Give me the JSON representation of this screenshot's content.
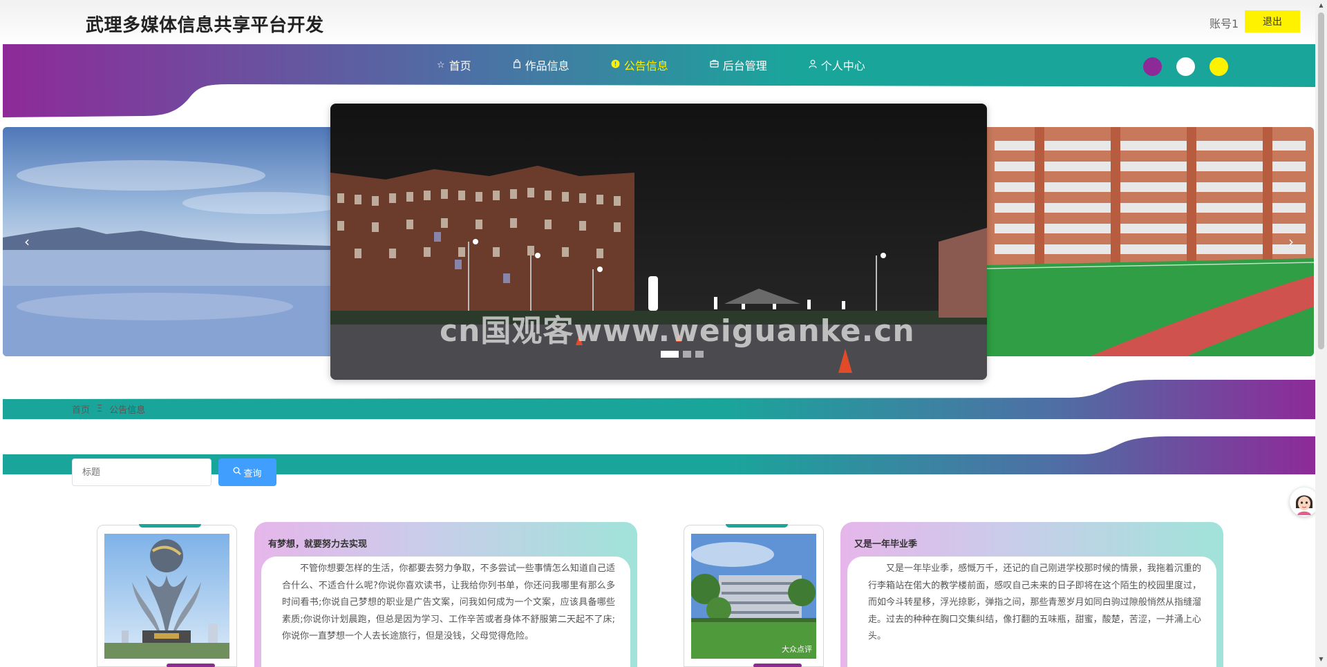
{
  "header": {
    "site_title": "武理多媒体信息共享平台开发",
    "account_label": "账号1",
    "logout_label": "退出"
  },
  "nav": {
    "items": [
      {
        "label": "首页",
        "icon": "star-icon",
        "active": false
      },
      {
        "label": "作品信息",
        "icon": "bag-icon",
        "active": false
      },
      {
        "label": "公告信息",
        "icon": "info-circle-icon",
        "active": true
      },
      {
        "label": "后台管理",
        "icon": "briefcase-icon",
        "active": false
      },
      {
        "label": "个人中心",
        "icon": "user-icon",
        "active": false
      }
    ],
    "theme_colors": [
      "#8e2a98",
      "#ffffff",
      "#fff200"
    ]
  },
  "colors": {
    "purple": "#8e2a98",
    "teal": "#1aa59b",
    "accent_yellow": "#fff200",
    "search_blue": "#409eff"
  },
  "carousel": {
    "watermark": "cn国观客www.weiguanke.cn",
    "slide_count": 3,
    "active_index": 0,
    "prev_icon": "chevron-left-icon",
    "next_icon": "chevron-right-icon"
  },
  "breadcrumb": {
    "home": "首页",
    "separator": "Ξ",
    "current": "公告信息"
  },
  "search": {
    "placeholder": "标题",
    "button_label": "查询",
    "button_icon": "search-icon"
  },
  "news": [
    {
      "title": "有梦想，就要努力去实现",
      "content": "不管你想要怎样的生活，你都要去努力争取，不多尝试一些事情怎么知道自己适合什么、不适合什么呢?你说你喜欢读书，让我给你列书单，你还问我哪里有那么多时间看书;你说自己梦想的职业是广告文案，问我如何成为一个文案，应该具备哪些素质;你说你计划晨跑，但总是因为学习、工作辛苦或者身体不舒服第二天起不了床;你说你一直梦想一个人去长途旅行，但是没钱，父母觉得危险。",
      "image_tag": ""
    },
    {
      "title": "又是一年毕业季",
      "content": "又是一年毕业季，感慨万千，还记的自己刚进学校那时候的情景，我拖着沉重的行李箱站在偌大的教学楼前面，感叹自己未来的日子即将在这个陌生的校园里度过，而如今斗转星移，浮光掠影，弹指之间，那些青葱岁月如同白驹过隙般悄然从指缝溜走。过去的种种在胸口交集纠结，像打翻的五味瓶，甜蜜，酸楚，苦涩，一并涌上心头。",
      "image_tag": "大众点评"
    }
  ]
}
